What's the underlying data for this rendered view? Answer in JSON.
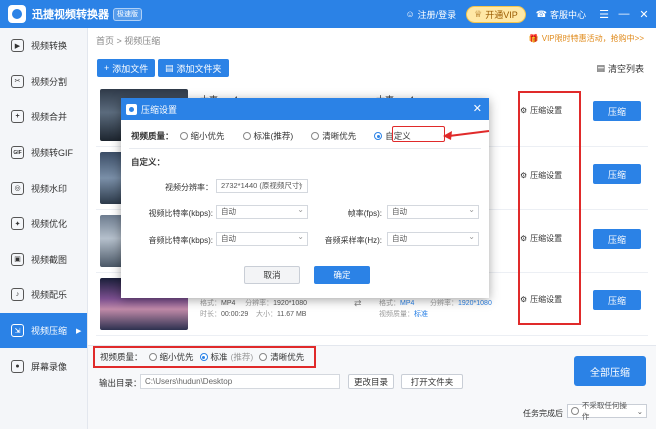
{
  "app": {
    "title": "迅捷视频转换器",
    "edition": "极速版"
  },
  "titlebar": {
    "login": "注册/登录",
    "vip": "开通VIP",
    "service": "客服中心"
  },
  "sidebar": {
    "items": [
      {
        "label": "视频转换",
        "icon": "convert-icon"
      },
      {
        "label": "视频分割",
        "icon": "split-icon"
      },
      {
        "label": "视频合并",
        "icon": "merge-icon"
      },
      {
        "label": "视频转GIF",
        "icon": "gif-icon"
      },
      {
        "label": "视频水印",
        "icon": "watermark-icon"
      },
      {
        "label": "视频优化",
        "icon": "optimize-icon"
      },
      {
        "label": "视频截图",
        "icon": "screenshot-icon"
      },
      {
        "label": "视频配乐",
        "icon": "music-icon"
      },
      {
        "label": "视频压缩",
        "icon": "compress-icon"
      },
      {
        "label": "屏幕录像",
        "icon": "record-icon"
      }
    ]
  },
  "breadcrumb": "首页 > 视频压缩",
  "promo": "VIP限时特惠活动，抢购中>>",
  "toolbar": {
    "add_file": "添加文件",
    "add_folder": "添加文件夹",
    "clear": "清空列表"
  },
  "files": [
    {
      "name": "大事.mp4",
      "name2": "大事.mp4"
    },
    {
      "name": "",
      "name2": ""
    },
    {
      "name": "",
      "name2": ""
    },
    {
      "format_label": "格式：",
      "format": "MP4",
      "res_label": "分辨率：",
      "res": "1920*1080",
      "dur_label": "时长：",
      "dur": "00:00:29",
      "size_label": "大小：",
      "size": "11.67 MB",
      "out_format_label": "格式：",
      "out_format": "MP4",
      "out_res_label": "分辨率：",
      "out_res": "1920*1080",
      "out_q_label": "视频质量：",
      "out_q": "标准"
    }
  ],
  "row_actions": {
    "settings": "压缩设置",
    "compress": "压缩"
  },
  "bottom": {
    "quality_label": "视频质量：",
    "opt_small": "缩小优先",
    "opt_standard": "标准",
    "opt_standard_note": "(推荐)",
    "opt_clear": "清晰优先",
    "output_label": "输出目录：",
    "output_path": "C:\\Users\\hudun\\Desktop",
    "change_dir": "更改目录",
    "open_folder": "打开文件夹",
    "compress_all": "全部压缩",
    "task_done_label": "任务完成后",
    "task_done_value": "不采取任何操作"
  },
  "dialog": {
    "title": "压缩设置",
    "quality_label": "视频质量：",
    "opt_small": "缩小优先",
    "opt_standard": "标准(推荐)",
    "opt_clear": "清晰优先",
    "opt_custom": "自定义",
    "custom_header": "自定义：",
    "res_label": "视频分辨率：",
    "res_value": "2732*1440 (原视频尺寸)",
    "vbitrate_label": "视频比特率(kbps):",
    "vbitrate_value": "自动",
    "fps_label": "帧率(fps):",
    "fps_value": "自动",
    "abitrate_label": "音频比特率(kbps):",
    "abitrate_value": "自动",
    "asample_label": "音频采样率(Hz):",
    "asample_value": "自动",
    "cancel": "取消",
    "ok": "确定"
  },
  "colors": {
    "primary": "#2b82e6",
    "highlight": "#e02a2a",
    "vip": "#f5c54a"
  }
}
